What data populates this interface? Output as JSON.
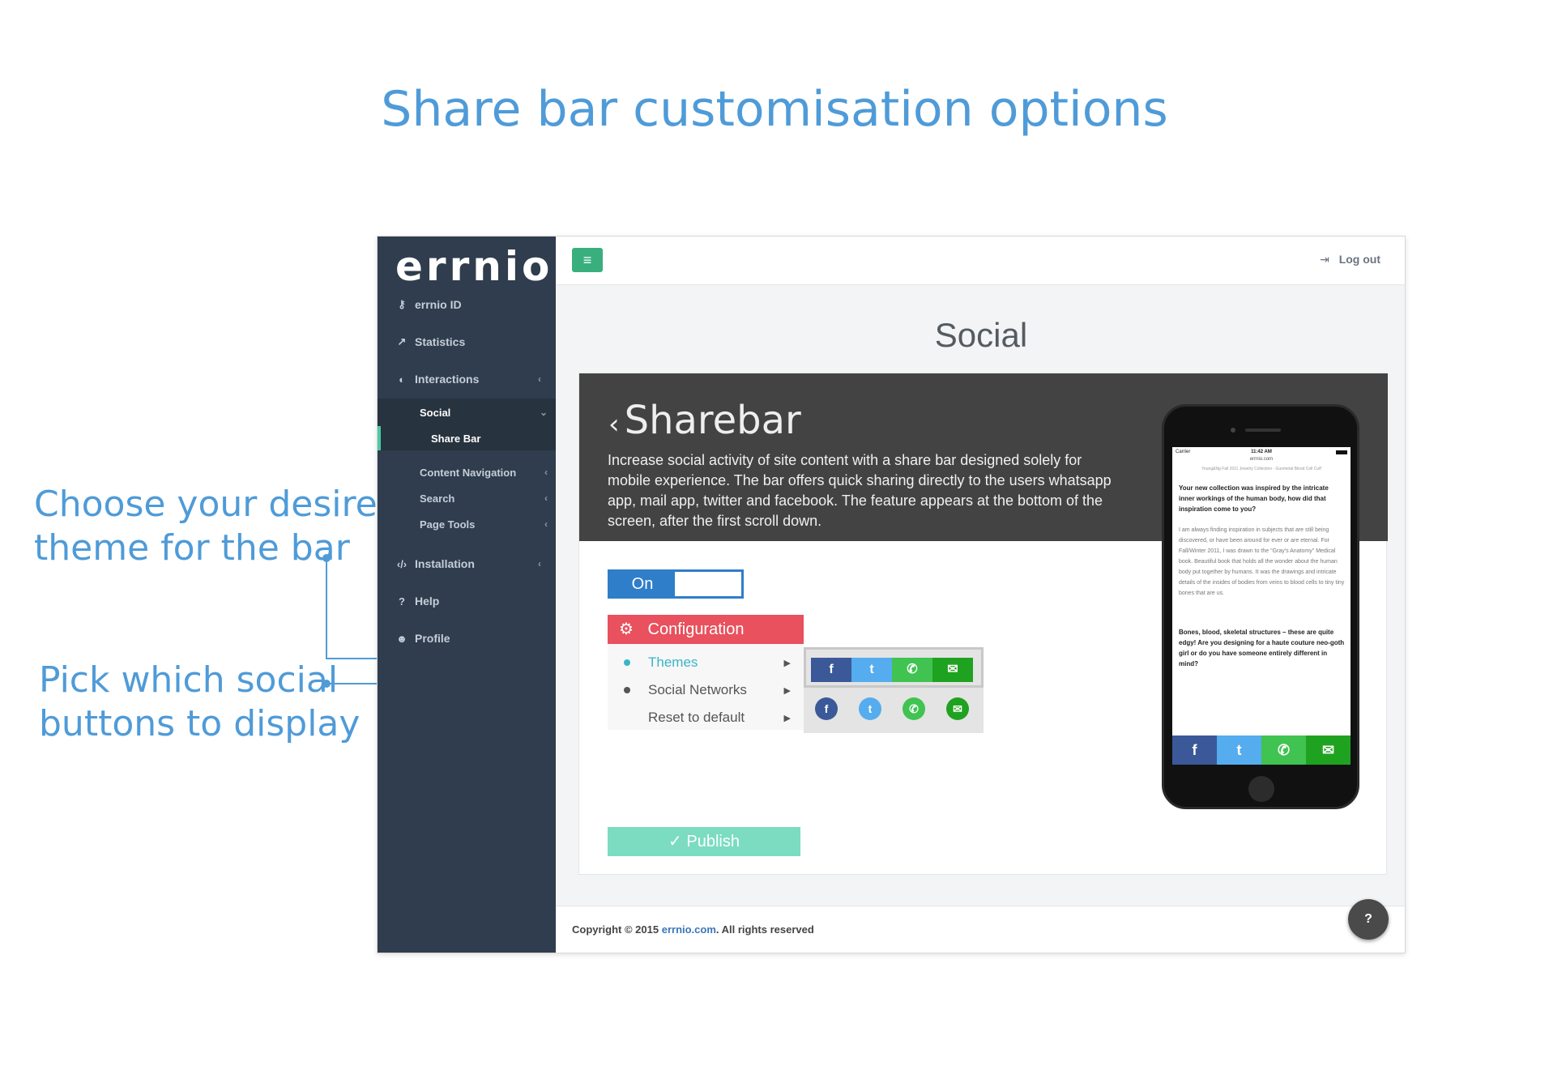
{
  "headline": "Share bar customisation options",
  "callouts": {
    "theme": [
      "Choose your desired",
      "theme for the bar"
    ],
    "social": [
      "Pick which social",
      "buttons to display"
    ]
  },
  "app": {
    "logo": "errnio",
    "sidebar": {
      "items": [
        {
          "label": "errnio ID",
          "icon": "key-icon"
        },
        {
          "label": "Statistics",
          "icon": "chart-icon"
        },
        {
          "label": "Interactions",
          "icon": "toggle-icon"
        },
        {
          "label": "Installation",
          "icon": "code-icon"
        },
        {
          "label": "Help",
          "icon": "question-icon"
        },
        {
          "label": "Profile",
          "icon": "user-icon"
        }
      ],
      "sub": {
        "social": "Social",
        "share_bar": "Share Bar",
        "content_navigation": "Content Navigation",
        "search": "Search",
        "page_tools": "Page Tools"
      }
    },
    "topbar": {
      "logout": "Log out"
    },
    "page_title": "Social",
    "banner": {
      "title": "Sharebar",
      "description": "Increase social activity of site content with a share bar designed solely for mobile experience. The bar offers quick sharing directly to the users whatsapp app, mail app, twitter and facebook. The feature appears at the bottom of the screen, after the first scroll down."
    },
    "toggle": {
      "label": "On",
      "state": "on"
    },
    "configuration": {
      "title": "Configuration",
      "menu": [
        "Themes",
        "Social Networks",
        "Reset to default"
      ],
      "selected": "Themes"
    },
    "publish_label": "Publish",
    "phone": {
      "carrier": "Carrier",
      "time": "11:42 AM",
      "url": "errnio.com",
      "breadcrumb": "Young&Ng Fall 2011 Jewelry Collection - Gunmetal Blood Cell Cuff",
      "question1": "Your new collection was inspired by the intricate inner workings of the human body, how did that inspiration come to you?",
      "answer1": "I am always finding inspiration in subjects that are still being discovered, or have been around for ever or are eternal. For Fall/Winter 2011, I was drawn to the \"Gray's Anatomy\" Medical book. Beautiful book that holds all the wonder about the human body put together by humans. It was the drawings and intricate details of the insides of bodies from veins to blood cells to tiny tiny bones that are us.",
      "question2": "Bones, blood, skeletal structures – these are quite edgy! Are you designing for a haute couture neo-goth girl or do you have someone entirely different in mind?"
    },
    "footer": {
      "prefix": "Copyright © 2015 ",
      "link": "errnio.com",
      "suffix": ". All rights reserved"
    },
    "colors": {
      "facebook": "#3b5998",
      "twitter": "#55acee",
      "whatsapp": "#40c351",
      "email": "#20a221",
      "accent": "#4f9bd8"
    }
  }
}
